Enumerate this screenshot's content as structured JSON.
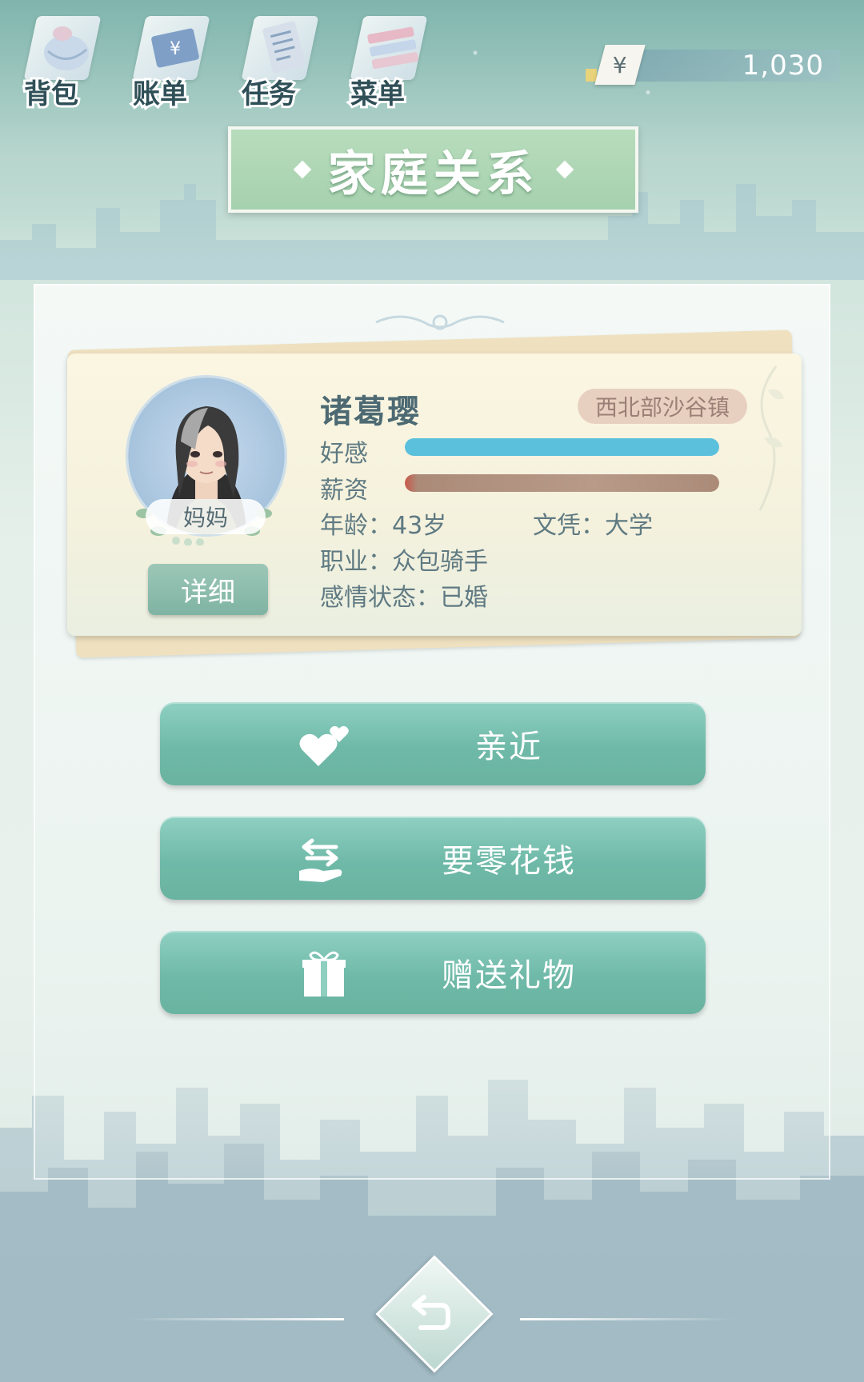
{
  "toolbar": {
    "items": [
      {
        "label": "背包",
        "icon": "bag-icon"
      },
      {
        "label": "账单",
        "icon": "bill-icon"
      },
      {
        "label": "任务",
        "icon": "task-icon"
      },
      {
        "label": "菜单",
        "icon": "menu-icon"
      }
    ]
  },
  "currency": {
    "symbol": "¥",
    "amount": "1,030"
  },
  "page": {
    "title": "家庭关系"
  },
  "character": {
    "name": "诸葛璎",
    "location": "西北部沙谷镇",
    "relation": "妈妈",
    "detail_label": "详细",
    "favor_label": "好感",
    "favor_value": 1.0,
    "salary_label": "薪资",
    "salary_value": 1.0,
    "age": "年龄：43岁",
    "education": "文凭：大学",
    "job": "职业：众包骑手",
    "relationship_status": "感情状态：已婚"
  },
  "actions": [
    {
      "label": "亲近",
      "icon": "hearts-icon"
    },
    {
      "label": "要零花钱",
      "icon": "exchange-hand-icon"
    },
    {
      "label": "赠送礼物",
      "icon": "gift-icon"
    }
  ],
  "colors": {
    "favor_bar": "#5bc0dc",
    "salary_bar": "#ab8a78",
    "button": "#73bcab",
    "title_plate": "#a9d3b1"
  }
}
